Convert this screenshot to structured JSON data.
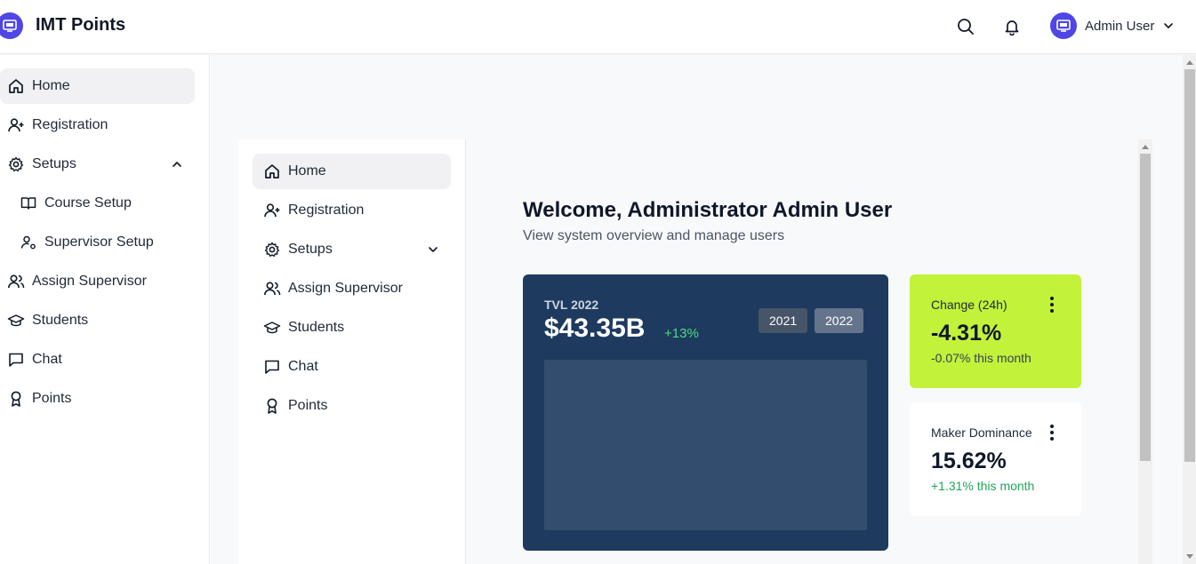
{
  "app": {
    "title": "IMT Points"
  },
  "header": {
    "user_name": "Admin User"
  },
  "sidebar": {
    "items": [
      {
        "label": "Home",
        "icon": "home-icon"
      },
      {
        "label": "Registration",
        "icon": "user-plus-icon"
      },
      {
        "label": "Setups",
        "icon": "gear-icon"
      },
      {
        "label": "Course Setup",
        "icon": "book-icon"
      },
      {
        "label": "Supervisor Setup",
        "icon": "user-gear-icon"
      },
      {
        "label": "Assign Supervisor",
        "icon": "users-icon"
      },
      {
        "label": "Students",
        "icon": "graduation-cap-icon"
      },
      {
        "label": "Chat",
        "icon": "chat-icon"
      },
      {
        "label": "Points",
        "icon": "award-icon"
      }
    ]
  },
  "inner_sidebar": {
    "items": [
      {
        "label": "Home"
      },
      {
        "label": "Registration"
      },
      {
        "label": "Setups"
      },
      {
        "label": "Assign Supervisor"
      },
      {
        "label": "Students"
      },
      {
        "label": "Chat"
      },
      {
        "label": "Points"
      }
    ]
  },
  "dashboard": {
    "welcome": "Welcome, Administrator Admin User",
    "subtitle": "View system overview and manage users",
    "tvl": {
      "label": "TVL 2022",
      "value": "$43.35B",
      "change": "+13%",
      "years": [
        "2021",
        "2022"
      ]
    },
    "stats": [
      {
        "label": "Change (24h)",
        "value": "-4.31%",
        "sub": "-0.07% this month"
      },
      {
        "label": "Maker Dominance",
        "value": "15.62%",
        "sub": "+1.31% this month"
      }
    ]
  },
  "colors": {
    "accent": "#4f46e5",
    "tvl_card": "#1e3a5f",
    "highlight_card": "#c2f23a",
    "positive": "#22a55a"
  }
}
